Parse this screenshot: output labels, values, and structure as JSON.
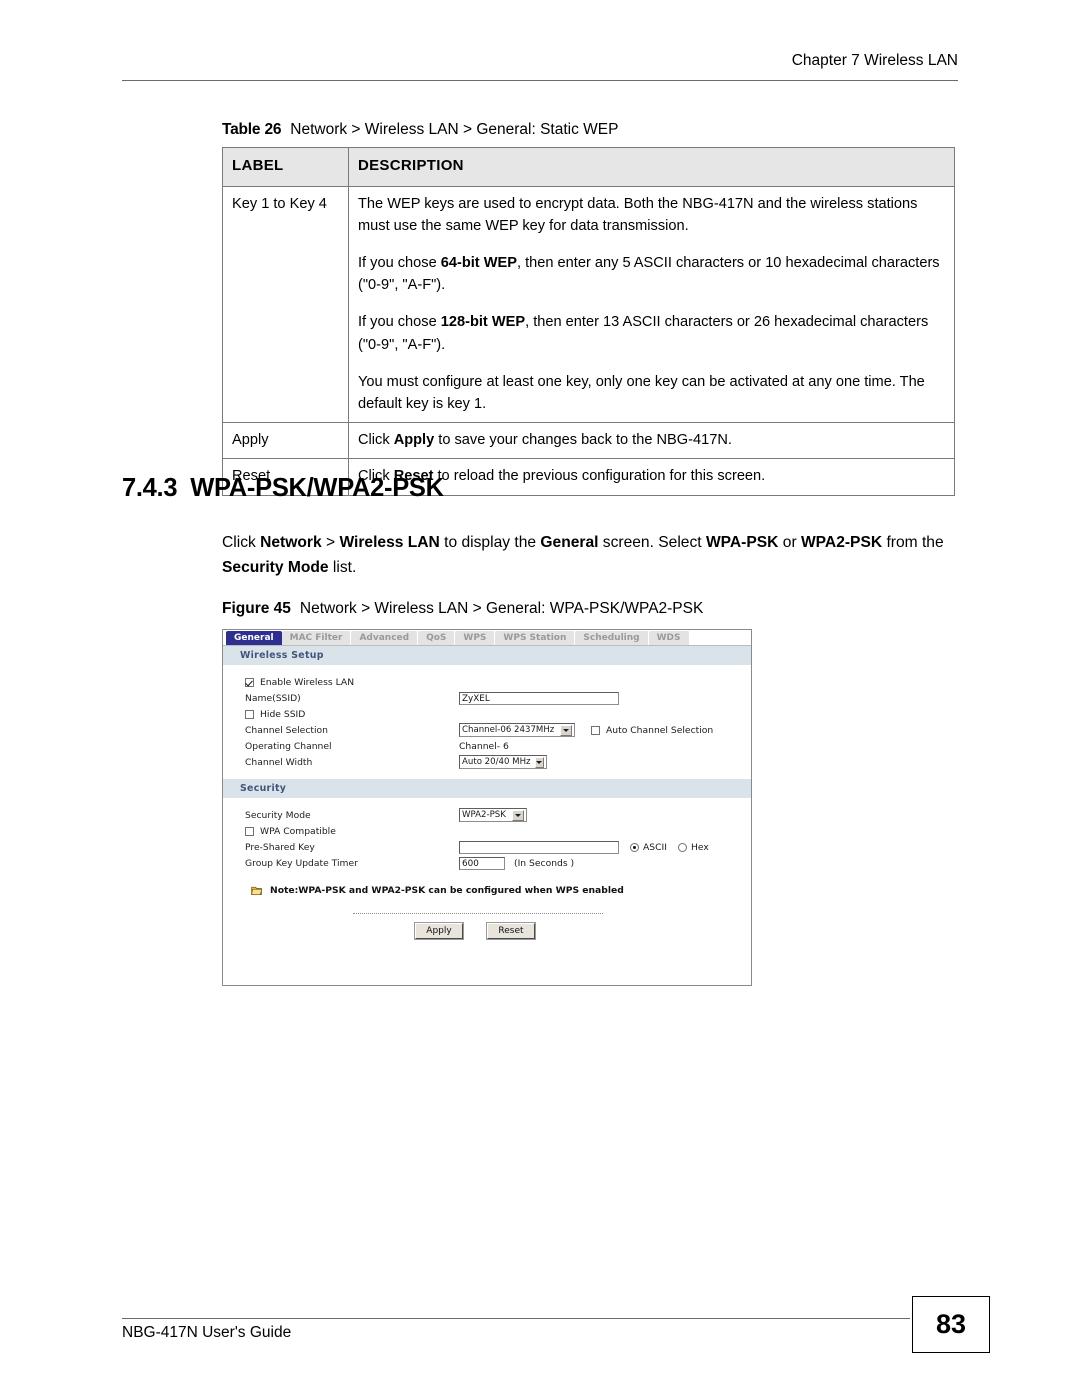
{
  "header": {
    "chapter": "Chapter 7 Wireless LAN"
  },
  "table_caption": {
    "label": "Table 26",
    "text": "Network > Wireless LAN > General: Static WEP"
  },
  "table": {
    "columns": [
      "LABEL",
      "DESCRIPTION"
    ],
    "rows": [
      {
        "label": "Key 1 to Key 4",
        "paragraphs": [
          "The WEP keys are used to encrypt data. Both the NBG-417N and the wireless stations must use the same WEP key for data transmission.",
          "If you chose 64-bit WEP, then enter any 5 ASCII characters or 10 hexadecimal characters (\"0-9\", \"A-F\").",
          "If you chose 128-bit WEP, then enter 13 ASCII characters or 26 hexadecimal characters (\"0-9\", \"A-F\").",
          "You must configure at least one key, only one key can be activated at any one time. The default key is key 1."
        ]
      },
      {
        "label": "Apply",
        "paragraphs": [
          "Click Apply to save your changes back to the NBG-417N."
        ]
      },
      {
        "label": "Reset",
        "paragraphs": [
          "Click Reset to reload the previous configuration for this screen."
        ]
      }
    ]
  },
  "section": {
    "number": "7.4.3",
    "title": "WPA-PSK/WPA2-PSK",
    "paragraph_line1_a": "Click ",
    "paragraph_network": "Network",
    "paragraph_gt1": " > ",
    "paragraph_wireless_lan": "Wireless LAN",
    "paragraph_line1_b": " to display the ",
    "paragraph_general": "General",
    "paragraph_line1_c": " screen. Select ",
    "paragraph_wpapsk": "WPA-PSK",
    "paragraph_line2_a": " or ",
    "paragraph_wpa2psk": "WPA2-PSK",
    "paragraph_line2_b": " from the ",
    "paragraph_security_mode": "Security Mode",
    "paragraph_line2_c": " list."
  },
  "figure_caption": {
    "label": "Figure 45",
    "text": "Network > Wireless LAN > General: WPA-PSK/WPA2-PSK"
  },
  "router_ui": {
    "tabs": [
      {
        "label": "General",
        "active": true
      },
      {
        "label": "MAC Filter",
        "active": false
      },
      {
        "label": "Advanced",
        "active": false
      },
      {
        "label": "QoS",
        "active": false
      },
      {
        "label": "WPS",
        "active": false
      },
      {
        "label": "WPS Station",
        "active": false
      },
      {
        "label": "Scheduling",
        "active": false
      },
      {
        "label": "WDS",
        "active": false
      }
    ],
    "wireless_setup": {
      "title": "Wireless Setup",
      "enable_wireless_lan_label": "Enable Wireless LAN",
      "enable_wireless_lan_checked": "checked",
      "ssid_label": "Name(SSID)",
      "ssid_value": "ZyXEL",
      "hide_ssid_label": "Hide SSID",
      "channel_selection_label": "Channel Selection",
      "channel_selection_value": "Channel-06 2437MHz",
      "auto_channel_label": "Auto Channel Selection",
      "operating_channel_label": "Operating Channel",
      "operating_channel_value": "Channel- 6",
      "channel_width_label": "Channel Width",
      "channel_width_value": "Auto 20/40 MHz"
    },
    "security": {
      "title": "Security",
      "security_mode_label": "Security Mode",
      "security_mode_value": "WPA2-PSK",
      "wpa_compatible_label": "WPA Compatible",
      "pre_shared_key_label": "Pre-Shared Key",
      "pre_shared_key_value": "",
      "ascii_label": "ASCII",
      "hex_label": "Hex",
      "group_key_timer_label": "Group Key Update Timer",
      "group_key_timer_value": "600",
      "group_key_timer_suffix": "(In Seconds )"
    },
    "note_text": "Note:WPA-PSK and WPA2-PSK can be configured when WPS enabled",
    "apply_label": "Apply",
    "reset_label": "Reset",
    "colors": {
      "active_tab": "#2f2f8f",
      "section_bar": "#dbe3ea",
      "section_bar_text": "#41547a",
      "inactive_tab": "#e3e3e3"
    }
  },
  "footer": {
    "guide": "NBG-417N User's Guide",
    "page_number": "83"
  }
}
